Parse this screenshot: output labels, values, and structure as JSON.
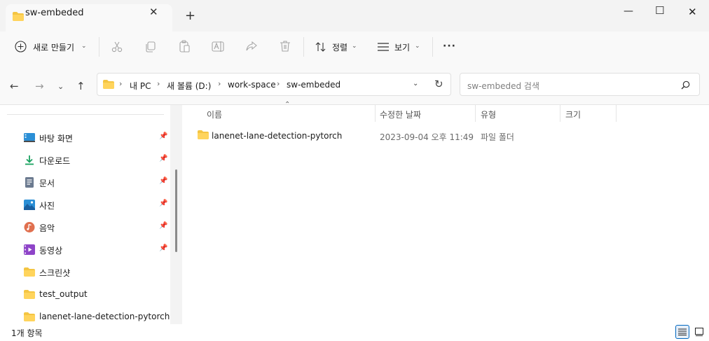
{
  "window": {
    "tab_title": "sw-embeded",
    "close_tab": "✕",
    "new_tab": "+",
    "minimize": "—",
    "maximize": "☐",
    "close": "✕"
  },
  "toolbar": {
    "new_label": "새로 만들기",
    "sort_label": "정렬",
    "view_label": "보기",
    "more": "···"
  },
  "address": {
    "crumbs": [
      "내 PC",
      "새 볼륨 (D:)",
      "work-space",
      "sw-embeded"
    ],
    "search_placeholder": "sw-embeded 검색"
  },
  "nav": {
    "items": [
      {
        "label": "바탕 화면",
        "icon": "desktop-icon",
        "pinned": true
      },
      {
        "label": "다운로드",
        "icon": "download-icon",
        "pinned": true
      },
      {
        "label": "문서",
        "icon": "document-icon",
        "pinned": true
      },
      {
        "label": "사진",
        "icon": "pictures-icon",
        "pinned": true
      },
      {
        "label": "음악",
        "icon": "music-icon",
        "pinned": true
      },
      {
        "label": "동영상",
        "icon": "video-icon",
        "pinned": true
      },
      {
        "label": "스크린샷",
        "icon": "folder-icon",
        "pinned": false
      },
      {
        "label": "test_output",
        "icon": "folder-icon",
        "pinned": false
      },
      {
        "label": "lanenet-lane-detection-pytorch",
        "icon": "folder-icon",
        "pinned": false
      }
    ]
  },
  "list": {
    "columns": [
      "이름",
      "수정한 날짜",
      "유형",
      "크기"
    ],
    "rows": [
      {
        "name": "lanenet-lane-detection-pytorch",
        "modified": "2023-09-04 오후 11:49",
        "type": "파일 폴더",
        "size": ""
      }
    ]
  },
  "status": {
    "count": "1개 항목"
  },
  "colors": {
    "folder": "#f4c542",
    "accent": "#0067c0"
  }
}
